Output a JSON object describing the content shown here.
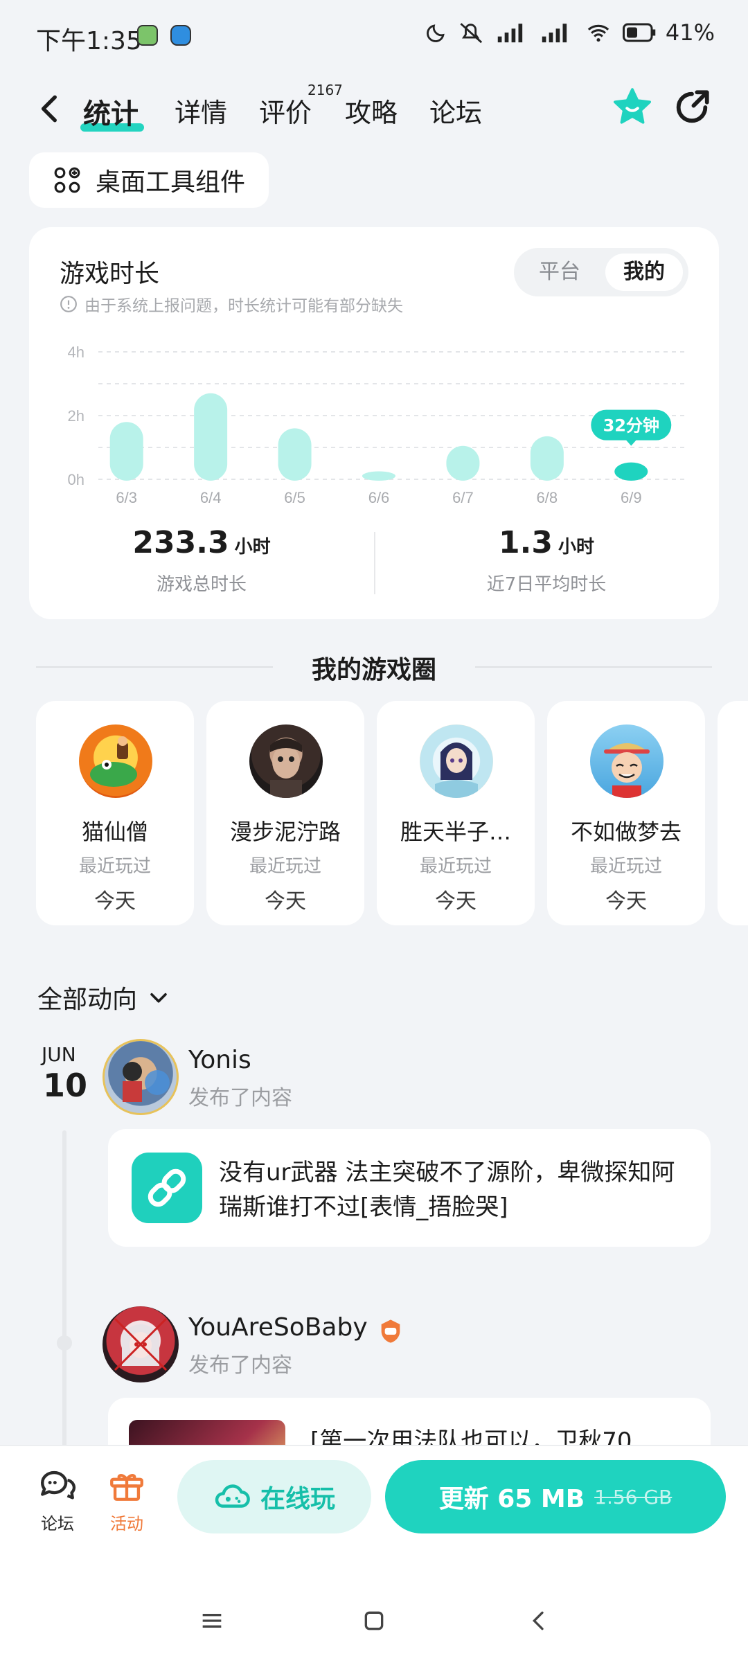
{
  "status_bar": {
    "time": "下午1:35",
    "battery": "41%"
  },
  "nav": {
    "tabs": [
      "统计",
      "详情",
      "评价",
      "攻略",
      "论坛"
    ],
    "review_count": "2167"
  },
  "widget_button": "桌面工具组件",
  "playtime_card": {
    "title": "游戏时长",
    "notice": "由于系统上报问题，时长统计可能有部分缺失",
    "toggle": {
      "platform": "平台",
      "mine": "我的"
    },
    "total": {
      "value": "233.3",
      "unit": "小时",
      "label": "游戏总时长"
    },
    "average": {
      "value": "1.3",
      "unit": "小时",
      "label": "近7日平均时长"
    }
  },
  "chart_data": {
    "type": "bar",
    "categories": [
      "6/3",
      "6/4",
      "6/5",
      "6/6",
      "6/7",
      "6/8",
      "6/9"
    ],
    "values": [
      1.8,
      2.7,
      1.6,
      0.25,
      1.05,
      1.35,
      0.53
    ],
    "yticks": [
      "4h",
      "2h",
      "0h"
    ],
    "ylim": [
      0,
      4
    ],
    "highlight_label": "32分钟",
    "bar_color": "#b8f2ea",
    "highlight_color": "#1fd3bf"
  },
  "circles": {
    "title": "我的游戏圈",
    "items": [
      {
        "name": "猫仙僧",
        "recent": "最近玩过",
        "when": "今天"
      },
      {
        "name": "漫步泥泞路",
        "recent": "最近玩过",
        "when": "今天"
      },
      {
        "name": "胜天半子…",
        "recent": "最近玩过",
        "when": "今天"
      },
      {
        "name": "不如做梦去",
        "recent": "最近玩过",
        "when": "今天"
      }
    ]
  },
  "feed": {
    "filter": "全部动向",
    "date_month": "JUN",
    "date_day": "10",
    "posts": [
      {
        "user": "Yonis",
        "action": "发布了内容",
        "text": "没有ur武器 法主突破不了源阶，卑微探知阿瑞斯谁打不过[表情_捂脸哭]"
      },
      {
        "user": "YouAreSoBaby",
        "action": "发布了内容",
        "text": "[第一次用法队也可以，卫秋70"
      }
    ]
  },
  "bottom_bar": {
    "forum": "论坛",
    "activity": "活动",
    "play_online": "在线玩",
    "update": "更新 65 MB",
    "update_old": "1.56 GB"
  },
  "colors": {
    "accent": "#1fd3bf",
    "accent_light": "#dff6f3",
    "activity": "#f07a3a"
  }
}
